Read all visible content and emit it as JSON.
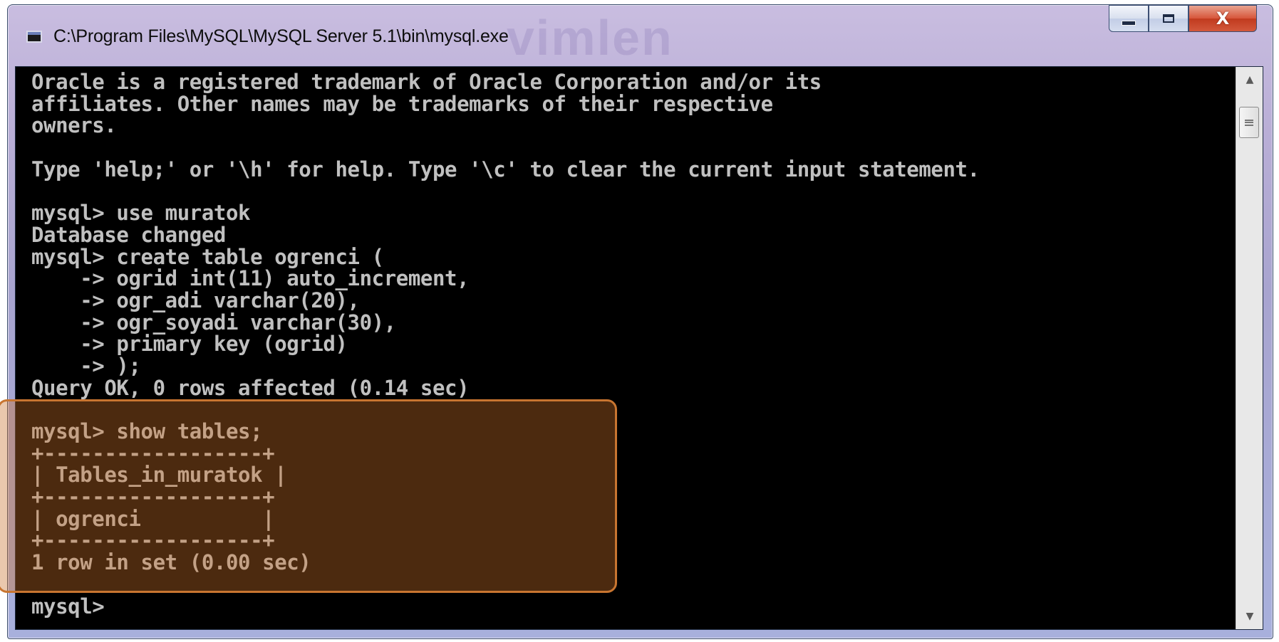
{
  "window": {
    "title": "C:\\Program Files\\MySQL\\MySQL Server 5.1\\bin\\mysql.exe",
    "watermark": "vimlen",
    "buttons": {
      "minimize": "minimize",
      "maximize": "maximize",
      "close": "X"
    }
  },
  "console": {
    "lines": [
      "Oracle is a registered trademark of Oracle Corporation and/or its",
      "affiliates. Other names may be trademarks of their respective",
      "owners.",
      "",
      "Type 'help;' or '\\h' for help. Type '\\c' to clear the current input statement.",
      "",
      "mysql> use muratok",
      "Database changed",
      "mysql> create table ogrenci (",
      "    -> ogrid int(11) auto_increment,",
      "    -> ogr_adi varchar(20),",
      "    -> ogr_soyadi varchar(30),",
      "    -> primary key (ogrid)",
      "    -> );",
      "Query OK, 0 rows affected (0.14 sec)",
      "",
      "mysql> show tables;",
      "+------------------+",
      "| Tables_in_muratok |",
      "+------------------+",
      "| ogrenci          |",
      "+------------------+",
      "1 row in set (0.00 sec)",
      "",
      "mysql>"
    ]
  },
  "colors": {
    "console_background": "#000000",
    "console_text": "#c0c0c0",
    "highlight": "#c87530"
  },
  "icons": {
    "window_icon": "console-icon",
    "scroll_up": "arrow-up-icon",
    "scroll_down": "arrow-down-icon"
  }
}
